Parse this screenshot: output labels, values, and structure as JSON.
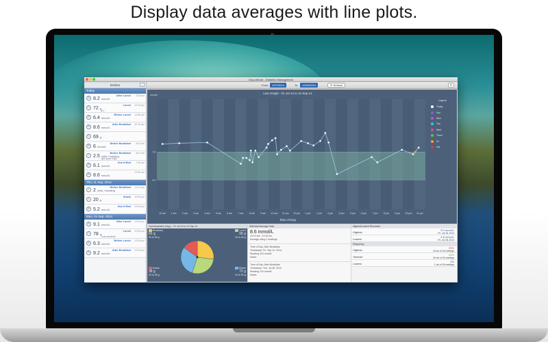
{
  "headline": "Display data averages with line plots.",
  "window": {
    "title": "GlucoSmart - Diabetes Management"
  },
  "sidebar": {
    "title": "Entries",
    "add_label": "+",
    "groups": [
      {
        "day": "Today",
        "entries": [
          {
            "icon": "B",
            "label": "After Lunch",
            "time": "3:25 pm",
            "value": "8.2",
            "unit": "mmol/L",
            "note": ""
          },
          {
            "icon": "C",
            "label": "Lunch",
            "time": "12:16 pm",
            "value": "72",
            "unit": "g",
            "note": "BLT"
          },
          {
            "icon": "B",
            "label": "Before Lunch",
            "time": "11:58 am",
            "value": "6.4",
            "unit": "mmol/L",
            "note": ""
          },
          {
            "icon": "B",
            "label": "After Breakfast",
            "time": "10:15 am",
            "value": "8.6",
            "unit": "mmol/L",
            "note": ""
          },
          {
            "icon": "C",
            "label": "",
            "time": "",
            "value": "69",
            "unit": "g",
            "note": ""
          },
          {
            "icon": "B",
            "label": "Before Breakfast",
            "time": "8:02 am",
            "value": "6",
            "unit": "mmol/L",
            "note": ""
          },
          {
            "icon": "I",
            "label": "Before Breakfast",
            "time": "8:01 am",
            "value": "2.5",
            "unit": "units, humalog",
            "note": "right upper thigh"
          },
          {
            "icon": "B",
            "label": "Out of Bed",
            "time": "7:48 am",
            "value": "6.1",
            "unit": "mmol/L",
            "note": ""
          },
          {
            "icon": "B",
            "label": "",
            "time": "12:00 am",
            "value": "8.6",
            "unit": "mmol/L",
            "note": ""
          }
        ]
      },
      {
        "day": "Thu, 11 Sep, 2014",
        "entries": [
          {
            "icon": "I",
            "label": "Before Breakfast",
            "time": "11:11 pm",
            "value": "2",
            "unit": "units, humalog",
            "note": ""
          },
          {
            "icon": "C",
            "label": "Snack",
            "time": "10:00 pm",
            "value": "20",
            "unit": "g",
            "note": ""
          },
          {
            "icon": "B",
            "label": "Out of Bed",
            "time": "10:00 pm",
            "value": "5.2",
            "unit": "mmol/L",
            "note": ""
          }
        ]
      },
      {
        "day": "Mon, 01 Sep, 2014",
        "entries": [
          {
            "icon": "B",
            "label": "After Lunch",
            "time": "12:00 pm",
            "value": "9.1",
            "unit": "mmol/L",
            "note": ""
          },
          {
            "icon": "C",
            "label": "Lunch",
            "time": "12:00 pm",
            "value": "78",
            "unit": "g",
            "note": "Tuna sandwich"
          },
          {
            "icon": "B",
            "label": "Before Lunch",
            "time": "12:00 pm",
            "value": "6.3",
            "unit": "mmol/L",
            "note": ""
          },
          {
            "icon": "B",
            "label": "After Breakfast",
            "time": "12:00 pm",
            "value": "9.2",
            "unit": "mmol/L",
            "note": ""
          }
        ]
      }
    ]
  },
  "toolbar": {
    "from_label": "From",
    "from_value": "1/07/2014",
    "to_label": "To",
    "to_value": "12/09/2014",
    "refresh_label": "Refresh",
    "export_label": "⇱"
  },
  "graph": {
    "legend_title": "Legend"
  },
  "chart_data": {
    "type": "line",
    "title": "Line Graph - 01 Jul 14 to 12 Sep 14",
    "ylabel": "mmol/L",
    "xlabel": "Time of Day",
    "categories": [
      "12 am",
      "1 am",
      "2 am",
      "3 am",
      "4 am",
      "5 am",
      "6 am",
      "7 am",
      "8 am",
      "9 am",
      "10 am",
      "11 am",
      "12 pm",
      "1 pm",
      "2 pm",
      "3 pm",
      "4 pm",
      "5 pm",
      "6 pm",
      "7 pm",
      "8 pm",
      "9 pm",
      "10 pm",
      "11 pm"
    ],
    "ylim": [
      0,
      15
    ],
    "yticks": [
      {
        "value": 4.0,
        "label": "4.0"
      },
      {
        "value": 7.8,
        "label": "7.8"
      }
    ],
    "target_band": [
      4.0,
      7.8
    ],
    "grid": true,
    "legend_position": "right",
    "legend": [
      {
        "name": "Today",
        "color": "#ffffff"
      },
      {
        "name": "Sun",
        "color": "#8b5cd6"
      },
      {
        "name": "Mon",
        "color": "#d24ec6"
      },
      {
        "name": "Tue",
        "color": "#36c6d8"
      },
      {
        "name": "Wed",
        "color": "#e845a3"
      },
      {
        "name": "Thurs",
        "color": "#5fc452"
      },
      {
        "name": "Fri",
        "color": "#f0a23a"
      },
      {
        "name": "Sat",
        "color": "#e33b35"
      }
    ],
    "series": [
      {
        "color": "#a9d3f5",
        "points": [
          {
            "x": 0.0,
            "y": 8.9
          },
          {
            "x": 1.5,
            "y": 9.0
          },
          {
            "x": 4.0,
            "y": 9.1
          },
          {
            "x": 7.0,
            "y": 6.2
          },
          {
            "x": 7.2,
            "y": 7.0
          },
          {
            "x": 7.5,
            "y": 7.0
          },
          {
            "x": 7.8,
            "y": 6.7
          },
          {
            "x": 7.9,
            "y": 8.0
          },
          {
            "x": 8.05,
            "y": 6.4
          },
          {
            "x": 8.3,
            "y": 8.0
          },
          {
            "x": 8.6,
            "y": 7.1
          },
          {
            "x": 9.3,
            "y": 8.4
          },
          {
            "x": 9.45,
            "y": 8.9
          },
          {
            "x": 9.8,
            "y": 9.4
          },
          {
            "x": 10.1,
            "y": 9.7
          },
          {
            "x": 10.25,
            "y": 7.5
          },
          {
            "x": 10.6,
            "y": 8.1
          },
          {
            "x": 11.1,
            "y": 8.6
          },
          {
            "x": 11.4,
            "y": 8.0
          },
          {
            "x": 12.4,
            "y": 9.3
          },
          {
            "x": 13.0,
            "y": 9.0
          },
          {
            "x": 13.5,
            "y": 8.7
          },
          {
            "x": 14.1,
            "y": 9.3
          },
          {
            "x": 14.55,
            "y": 10.4
          },
          {
            "x": 14.85,
            "y": 9.1
          },
          {
            "x": 15.6,
            "y": 4.8
          },
          {
            "x": 18.7,
            "y": 7.1
          },
          {
            "x": 19.2,
            "y": 6.4
          },
          {
            "x": 21.4,
            "y": 8.1
          },
          {
            "x": 22.4,
            "y": 7.5
          },
          {
            "x": 22.9,
            "y": 8.4
          }
        ]
      }
    ],
    "markers": [
      {
        "x": 22.6,
        "y": 7.8,
        "color": "#f0a23a"
      }
    ]
  },
  "carbs": {
    "title": "Carbohydrates (Avg.) - 01 Jul 14 to 12 Sep 14",
    "meals": [
      {
        "name": "Breakfast",
        "value": "65 g",
        "range": "30 to 80 g",
        "color": "#f7c84a",
        "pct": 27
      },
      {
        "name": "Lunch",
        "value": "68 g",
        "range": "30 to 85 g",
        "color": "#b9d97a",
        "pct": 28
      },
      {
        "name": "Dinner",
        "value": "72 g",
        "range": "40 to 90 g",
        "color": "#75b8e6",
        "pct": 30
      },
      {
        "name": "Snack",
        "value": "38 g",
        "range": "20 to 50 g",
        "color": "#e65a55",
        "pct": 15
      }
    ]
  },
  "selected": {
    "title": "Selected Average Data",
    "value": "8.6 mmol/L",
    "range": "10:10 am - 10:15 am",
    "avg_note": "Average using 2 readings",
    "readings": [
      {
        "head": "Time of Day: After Breakfast",
        "ts": "Timestamp: Fri, Sep 12, 2014",
        "reading": "Reading: 8.6 mmol/L",
        "notes": "Notes:"
      },
      {
        "head": "Time of Day: After Breakfast",
        "ts": "Timestamp: Tue, Jul 08, 2014",
        "reading": "Reading: 8.6 mmol/L",
        "notes": "Notes:"
      }
    ]
  },
  "highlow": {
    "title": "Highest/Lowest Recorded",
    "rows": [
      {
        "label": "Highest",
        "value": "9.9 mmol/L",
        "sub": "Fri, Jul 18, 2014"
      },
      {
        "label": "Lowest",
        "value": "4.8 mmol/L",
        "sub": "Fri, Jul 18, 2014"
      }
    ],
    "freq_title": "Frequency",
    "freq": [
      {
        "label": "Highest",
        "value": "53%",
        "sub": "18 out of 34 readings",
        "color": "#e33b35"
      },
      {
        "label": "'Normal'",
        "value": "44%",
        "sub": "15 out of 34 readings",
        "color": "#5fb04a"
      },
      {
        "label": "Lowest",
        "value": "3%",
        "sub": "1 out of 34 readings",
        "color": "#2d62c0"
      }
    ]
  }
}
